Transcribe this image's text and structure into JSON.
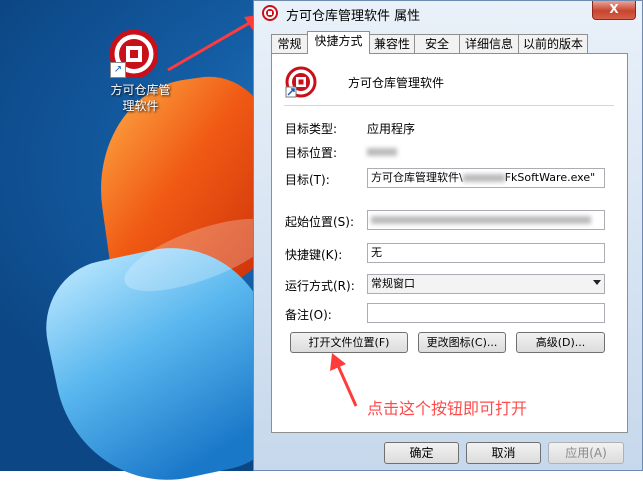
{
  "desktop": {
    "icon_label": "方可仓库管理软件"
  },
  "window": {
    "title": "方可仓库管理软件 属性",
    "close_label": "X"
  },
  "tabs": [
    {
      "label": "常规"
    },
    {
      "label": "快捷方式"
    },
    {
      "label": "兼容性"
    },
    {
      "label": "安全"
    },
    {
      "label": "详细信息"
    },
    {
      "label": "以前的版本"
    }
  ],
  "shortcut": {
    "app_name": "方可仓库管理软件",
    "target_type_label": "目标类型:",
    "target_type_value": "应用程序",
    "target_location_label": "目标位置:",
    "target_label": "目标(T):",
    "target_value_prefix": "方可仓库管理软件\\",
    "target_value_suffix": "FkSoftWare.exe\"",
    "start_in_label": "起始位置(S):",
    "hotkey_label": "快捷键(K):",
    "hotkey_value": "无",
    "run_label": "运行方式(R):",
    "run_value": "常规窗口",
    "comment_label": "备注(O):",
    "comment_value": "",
    "open_location_button": "打开文件位置(F)",
    "change_icon_button": "更改图标(C)...",
    "advanced_button": "高级(D)..."
  },
  "annotation": {
    "text": "点击这个按钮即可打开",
    "color": "#ff4b4b"
  },
  "footer": {
    "ok": "确定",
    "cancel": "取消",
    "apply": "应用(A)"
  }
}
